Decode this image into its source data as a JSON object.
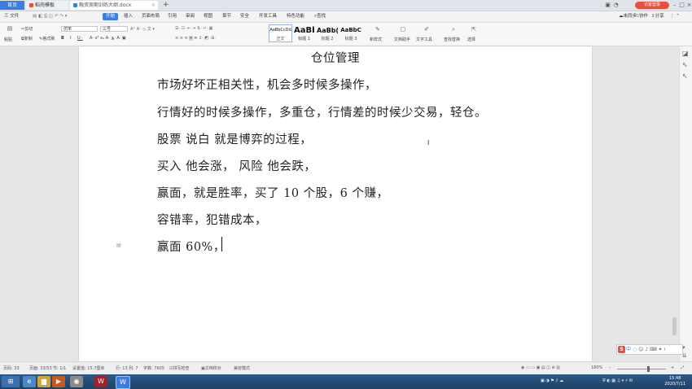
{
  "tabs": {
    "home": "首页",
    "template": "稻壳模板",
    "document": "融资周期训练大纲.docx",
    "login": "访客登录"
  },
  "menu": {
    "file": "三 文件",
    "start": "开始",
    "items": [
      "插入",
      "页面布局",
      "引用",
      "审阅",
      "视图",
      "章节",
      "安全",
      "开发工具",
      "特色功能"
    ],
    "search": "查找",
    "right": [
      "未同步",
      "协作",
      "分享"
    ]
  },
  "ribbon": {
    "clipboard": [
      "粘贴",
      "剪切",
      "复制",
      "格式刷"
    ],
    "font_name": "仿宋",
    "font_size": "三号",
    "styles": [
      {
        "preview": "AaBbCcDd",
        "label": "正文"
      },
      {
        "preview": "AaBb",
        "label": "标题 1"
      },
      {
        "preview": "AaBb(",
        "label": "标题 2"
      },
      {
        "preview": "AaBbC",
        "label": "标题 3"
      }
    ],
    "tools": [
      "新样式",
      "文档助手",
      "文字工具",
      "查找替换",
      "选择"
    ]
  },
  "document": {
    "title": "仓位管理",
    "lines": [
      "市场好坏正相关性，机会多时候多操作，",
      "行情好的时候多操作，多重仓，行情差的时候少交易，轻仓。",
      "股票 说白 就是博弈的过程，",
      "买入  他会涨，  风险   他会跌，",
      "赢面，就是胜率，买了 10 个股，6 个赚，",
      "容错率，犯错成本，",
      "赢面 60%，"
    ]
  },
  "ime": {
    "label": "中"
  },
  "status": {
    "page": "页码: 33",
    "pages": "页面: 33/53",
    "section": "节: 1/1",
    "position": "设置值: 15.7厘米",
    "row": "行: 13",
    "col": "列: 7",
    "words": "字数: 7605",
    "spell": "拼写检查",
    "doc_check": "文档校对",
    "compat": "兼容模式",
    "zoom": "180%"
  },
  "taskbar": {
    "time": "15:48",
    "date": "2020/7/11"
  },
  "colors": {
    "accent": "#3b7de0",
    "login": "#e84f3d"
  }
}
